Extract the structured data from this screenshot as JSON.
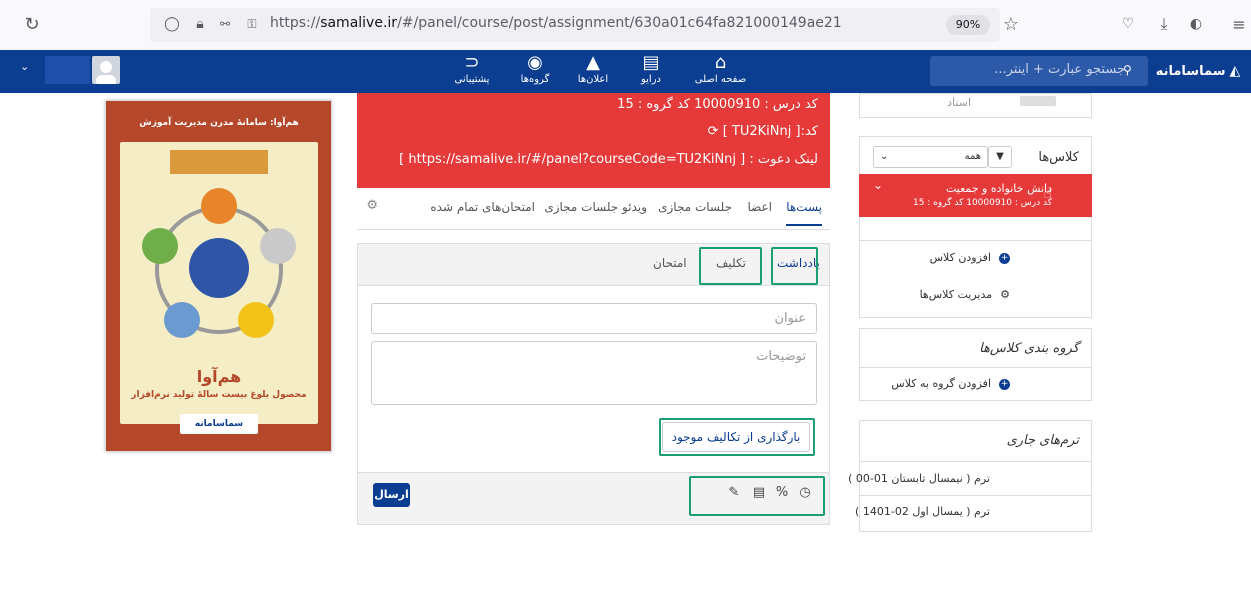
{
  "browser": {
    "url_prefix": "https://",
    "url_domain": "samalive.ir",
    "url_path": "/#/panel/course/post/assignment/630a01c64fa821000149ae21",
    "zoom": "90%"
  },
  "appnav": {
    "items": [
      {
        "label": "پشتیبانی",
        "icon": "rss-icon"
      },
      {
        "label": "گروه‌ها",
        "icon": "globe-icon"
      },
      {
        "label": "اعلان‌ها",
        "icon": "bell-icon"
      },
      {
        "label": "درایو",
        "icon": "drive-icon"
      },
      {
        "label": "صفحه اصلی",
        "icon": "home-icon"
      }
    ],
    "search_placeholder": "جستجو عبارت + اینتر...",
    "logo_text": "سماسامانه"
  },
  "poster": {
    "title": "هم‌آوا: سامانهٔ مدرن مدیریت آموزش",
    "main": "هم‌آوا",
    "sub": "محصول بلوغ بیست سالهٔ تولید نرم‌افزار",
    "logo": "سماسامانه"
  },
  "course": {
    "line1": "کد درس : 10000910   کد گروه : 15",
    "code_label": "کد:",
    "code": "[ TU2KiNnj ]",
    "invite_label": "لینک دعوت :",
    "invite_link": "[ https://samalive.ir/#/panel?courseCode=TU2KiNnj ]"
  },
  "tabs": [
    "پست‌ها",
    "اعضا",
    "جلسات مجازی",
    "ویدئو جلسات مجازی",
    "امتحان‌های تمام شده"
  ],
  "post": {
    "tabs": [
      "یادداشت",
      "تکلیف",
      "امتحان"
    ],
    "title_placeholder": "عنوان",
    "desc_placeholder": "توضیحات",
    "load_button": "بارگذاری از تکالیف موجود",
    "send_button": "ارسال"
  },
  "sidebar": {
    "teacher": "استاد",
    "classes_title": "کلاس‌ها",
    "filter_value": "همه",
    "active_class_name": "دانش خانواده و جمعیت",
    "active_class_info": "کد درس : 10000910   کد گروه : 15",
    "add_class": "افزودن کلاس",
    "manage_classes": "مدیریت کلاس‌ها",
    "group_title": "گروه بندی کلاس‌ها",
    "add_group": "افزودن گروه به کلاس",
    "terms_title": "ترم‌های جاری",
    "term1": "ترم ( نیمسال تابستان 01-00 )",
    "term2": "ترم ( یمسال اول 02-1401 )"
  }
}
